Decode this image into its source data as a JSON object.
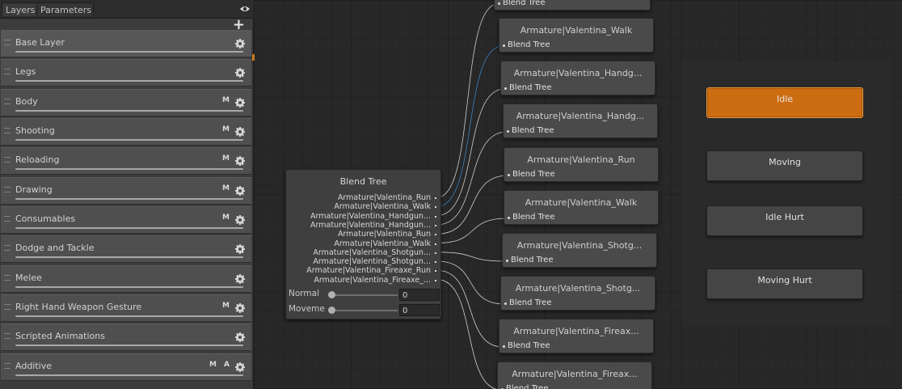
{
  "tabs": {
    "layers": "Layers",
    "parameters": "Parameters"
  },
  "panel": {
    "add_label": "+"
  },
  "layers": [
    {
      "name": "Base Layer",
      "flags": "",
      "selected": true
    },
    {
      "name": "Legs",
      "flags": ""
    },
    {
      "name": "Body",
      "flags": "M"
    },
    {
      "name": "Shooting",
      "flags": "M"
    },
    {
      "name": "Reloading",
      "flags": "M"
    },
    {
      "name": "Drawing",
      "flags": "M"
    },
    {
      "name": "Consumables",
      "flags": "M"
    },
    {
      "name": "Dodge and Tackle",
      "flags": ""
    },
    {
      "name": "Melee",
      "flags": ""
    },
    {
      "name": "Right Hand Weapon Gesture",
      "flags": "M"
    },
    {
      "name": "Scripted Animations",
      "flags": ""
    },
    {
      "name": "Additive",
      "flags": "M A"
    }
  ],
  "blend_tree": {
    "title": "Blend Tree",
    "motions": [
      "Armature|Valentina_Run",
      "Armature|Valentina_Walk",
      "Armature|Valentina_Handgun...",
      "Armature|Valentina_Handgun...",
      "Armature|Valentina_Run",
      "Armature|Valentina_Walk",
      "Armature|Valentina_Shotgun...",
      "Armature|Valentina_Shotgun...",
      "Armature|Valentina_Fireaxe_Run",
      "Armature|Valentina_Fireaxe_..."
    ],
    "params": [
      {
        "name": "Normal",
        "value": "0"
      },
      {
        "name": "Moveme",
        "value": "0"
      }
    ]
  },
  "motion_nodes": {
    "sub_label": "Blend Tree",
    "items": [
      {
        "title": ""
      },
      {
        "title": "Armature|Valentina_Walk"
      },
      {
        "title": "Armature|Valentina_Handg..."
      },
      {
        "title": "Armature|Valentina_Handg..."
      },
      {
        "title": "Armature|Valentina_Run"
      },
      {
        "title": "Armature|Valentina_Walk"
      },
      {
        "title": "Armature|Valentina_Shotg..."
      },
      {
        "title": "Armature|Valentina_Shotg..."
      },
      {
        "title": "Armature|Valentina_Fireax..."
      },
      {
        "title": "Armature|Valentina_Fireax..."
      }
    ]
  },
  "states": [
    {
      "name": "Idle",
      "default": true
    },
    {
      "name": "Moving"
    },
    {
      "name": "Idle Hurt"
    },
    {
      "name": "Moving Hurt"
    }
  ],
  "colors": {
    "accent": "#cd6d12",
    "node": "#4a4a4a",
    "panel": "#3c3c3c",
    "wire": "#d0d0d0",
    "active_wire": "#3b83c4"
  },
  "icons": {
    "eye": "eye-icon",
    "add": "plus-icon",
    "gear": "gear-icon",
    "handle": "drag-handle-icon"
  }
}
